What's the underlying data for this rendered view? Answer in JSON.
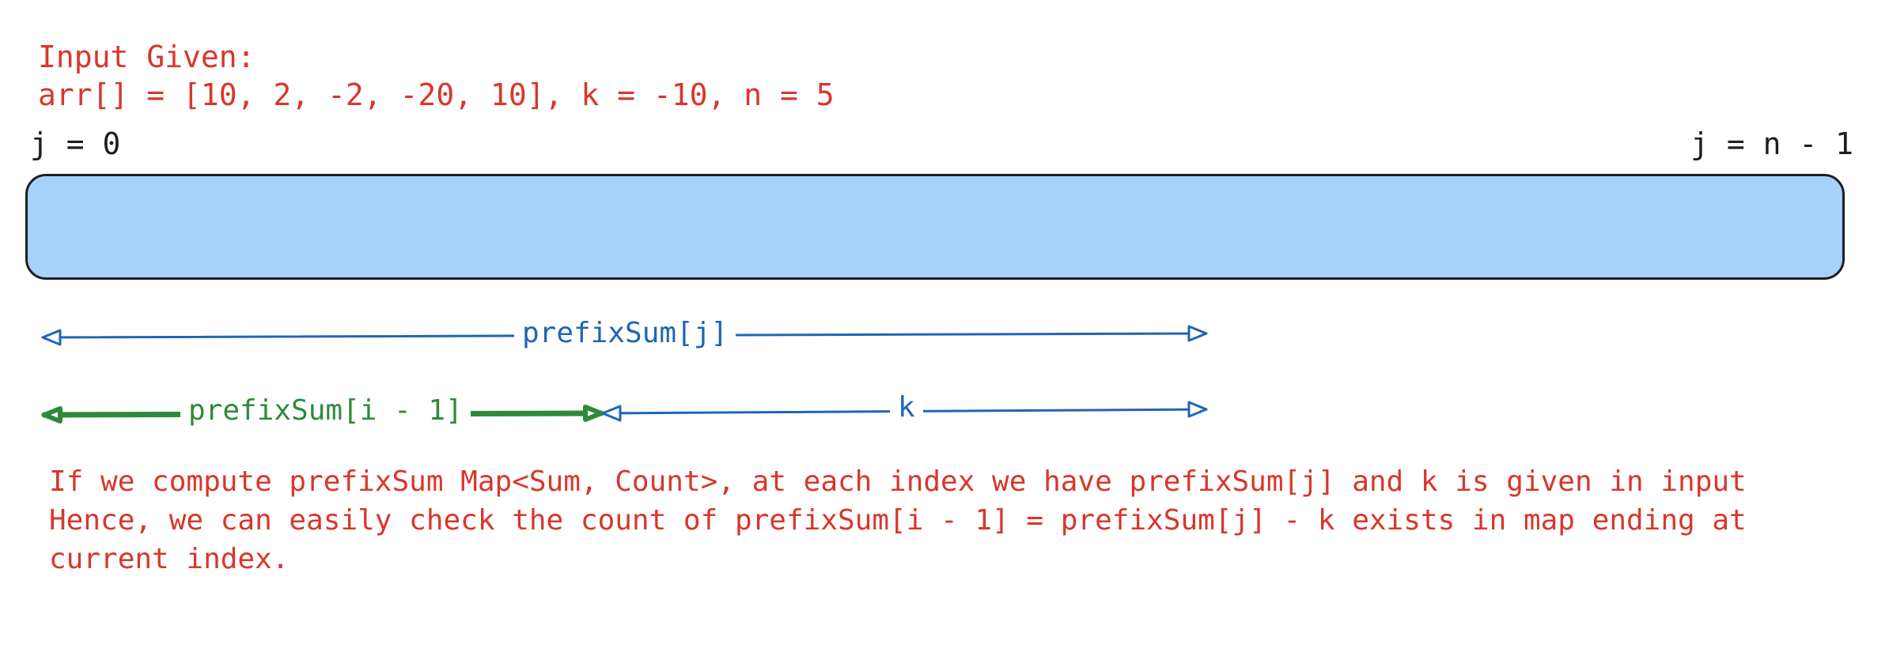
{
  "input": {
    "title": "Input Given:",
    "line": "arr[] = [10, 2, -2, -20, 10], k = -10, n = 5"
  },
  "indices": {
    "start": "j = 0",
    "end": "j = n - 1"
  },
  "arrows": {
    "prefix_sum_j": "prefixSum[j]",
    "prefix_sum_i_minus_1": "prefixSum[i - 1]",
    "k": "k"
  },
  "explanation": {
    "lines": [
      "If we compute prefixSum Map<Sum, Count>, at each index we have prefixSum[j] and k is given in input",
      "Hence, we can easily check the count of prefixSum[i - 1] = prefixSum[j] - k exists in map ending at",
      "current index."
    ]
  },
  "colors": {
    "text_red": "#d9362b",
    "bar_fill": "#a5d1fb",
    "arrow_blue": "#1f65b8",
    "arrow_green": "#2e8a3a"
  }
}
